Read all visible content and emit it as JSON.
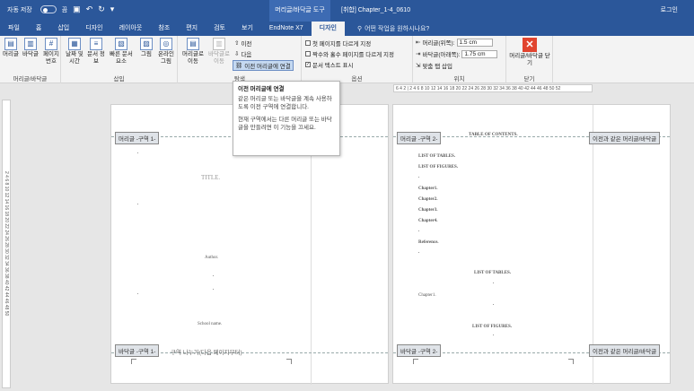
{
  "titlebar": {
    "autosave_label": "자동 저장",
    "autosave_state": "끔",
    "contextual_tab": "머리글/바닥글 도구",
    "document_title": "[취합] Chapter_1-4_0610",
    "login": "로그인"
  },
  "tabs": [
    "파일",
    "홈",
    "삽입",
    "디자인",
    "레이아웃",
    "참조",
    "편지",
    "검토",
    "보기",
    "EndNote X7",
    "디자인"
  ],
  "active_tab": "디자인",
  "tellme": "어떤 작업을 원하시나요?",
  "ribbon": {
    "hf_group": {
      "label": "머리글/바닥글",
      "header": "머리글",
      "footer": "바닥글",
      "page_number": "페이지 번호"
    },
    "insert_group": {
      "label": "삽입",
      "datetime": "날짜 및 시간",
      "docinfo": "문서 정보",
      "quickparts": "빠른 문서 요소",
      "picture": "그림",
      "online_picture": "온라인 그림"
    },
    "nav_group": {
      "label": "탐색",
      "goto_header": "머리글로 이동",
      "goto_footer": "바닥글로 이동",
      "previous": "이전",
      "next": "다음",
      "link_previous": "이전 머리글에 연결"
    },
    "options_group": {
      "label": "옵션",
      "diff_first": "첫 페이지를 다르게 지정",
      "diff_odd_even": "짝수와 홀수 페이지를 다르게 지정",
      "show_doc_text": "문서 텍스트 표시",
      "show_doc_text_checked": true
    },
    "position_group": {
      "label": "위치",
      "header_top": "머리글(위쪽):",
      "header_top_value": "1.5 cm",
      "footer_bottom": "바닥글(아래쪽):",
      "footer_bottom_value": "1.75 cm",
      "align_tab": "맞춤 탭 삽입"
    },
    "close_group": {
      "label": "닫기",
      "close": "머리글/바닥글 닫기"
    }
  },
  "tooltip": {
    "title": "이전 머리글에 연결",
    "p1": "같은 머리글 또는 바닥글을 계속 사용하도록 이전 구역에 연결합니다.",
    "p2": "현재 구역에서는 다른 머리글 또는 바닥글을 만들려면 이 기능을 끄세요."
  },
  "ruler": "6 4 2 | 2 4 6 8 10 12 14 16 18 20 22 24 26 28 30 32 34 36 38 40 42 44 46 48 50 52",
  "vruler": "2 4 6 8 10 12 14 16 18 20 22 24 26 28 30 32 34 36 38 40 42 44 46 48 50",
  "page1": {
    "header_tag": "머리글 -구역 1-",
    "footer_tag": "바닥글 -구역 1-",
    "title": "TITLE.",
    "author": "Author.",
    "school": "School name."
  },
  "page2": {
    "header_tag": "머리글 -구역 2-",
    "header_same": "이전과 같은 머리글/바닥글",
    "footer_tag": "바닥글 -구역 2-",
    "footer_same": "이전과 같은 머리글/바닥글",
    "toc_title": "TABLE OF CONTENTS.",
    "entries": [
      "LIST OF TABLES.",
      "LIST OF FIGURES.",
      "Chapter1.",
      "Chapter2.",
      "Chapter3.",
      "Chapter4.",
      "Reference."
    ],
    "list_tables": "LIST OF TABLES.",
    "chapter1": "Chapter1.",
    "list_figures": "LIST OF FIGURES."
  },
  "section_break": "구역 나누기(다음 페이지부터)"
}
